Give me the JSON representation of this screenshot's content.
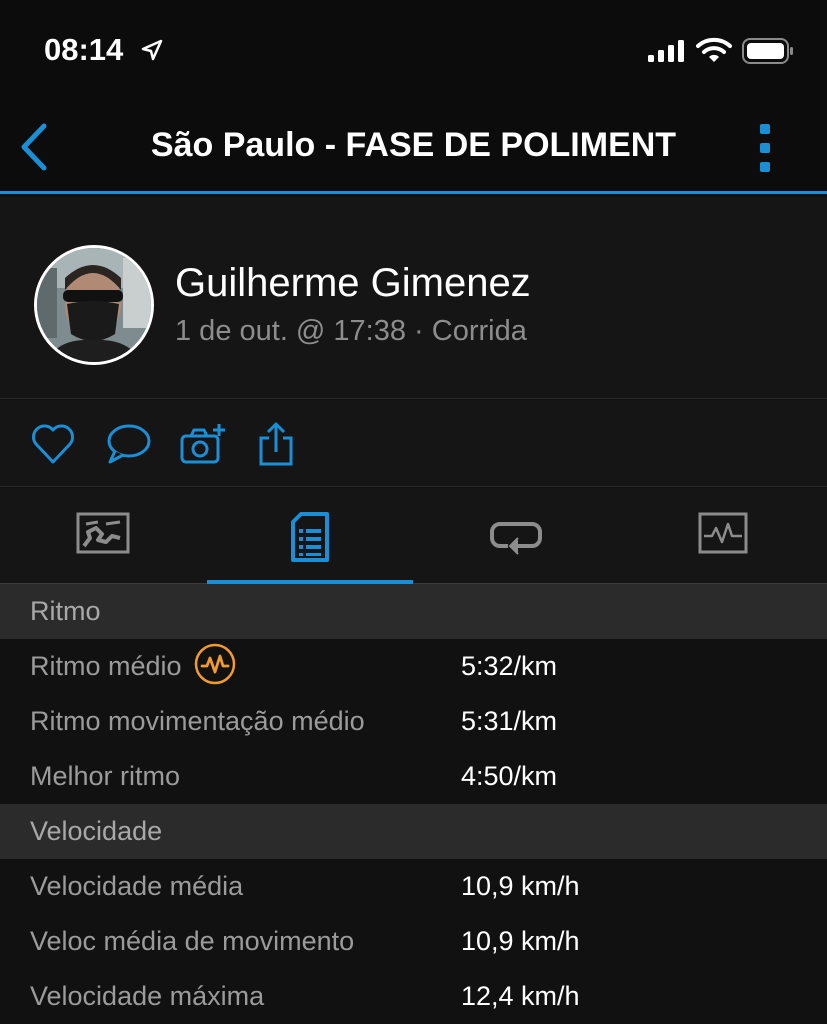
{
  "status_bar": {
    "time": "08:14"
  },
  "nav": {
    "title": "São Paulo - FASE DE POLIMENT"
  },
  "profile": {
    "name": "Guilherme Gimenez",
    "meta": "1 de out. @ 17:38 · Corrida"
  },
  "colors": {
    "accent": "#1b8fd6",
    "badge": "#f29a2e",
    "background": "#111111",
    "section_header": "#2b2b2b"
  },
  "icons": {
    "actions": [
      "heart-icon",
      "comment-icon",
      "camera-add-icon",
      "share-icon"
    ],
    "tabs": [
      "map-icon",
      "details-icon",
      "laps-icon",
      "chart-icon"
    ],
    "active_tab": 1
  },
  "sections": [
    {
      "title": "Ritmo",
      "rows": [
        {
          "label": "Ritmo médio",
          "value": "5:32/km"
        },
        {
          "label": "Ritmo movimentação médio",
          "value": "5:31/km"
        },
        {
          "label": "Melhor ritmo",
          "value": "4:50/km"
        }
      ]
    },
    {
      "title": "Velocidade",
      "rows": [
        {
          "label": "Velocidade média",
          "value": "10,9 km/h"
        },
        {
          "label": "Veloc média de movimento",
          "value": "10,9 km/h"
        },
        {
          "label": "Velocidade máxima",
          "value": "12,4 km/h"
        }
      ]
    }
  ]
}
